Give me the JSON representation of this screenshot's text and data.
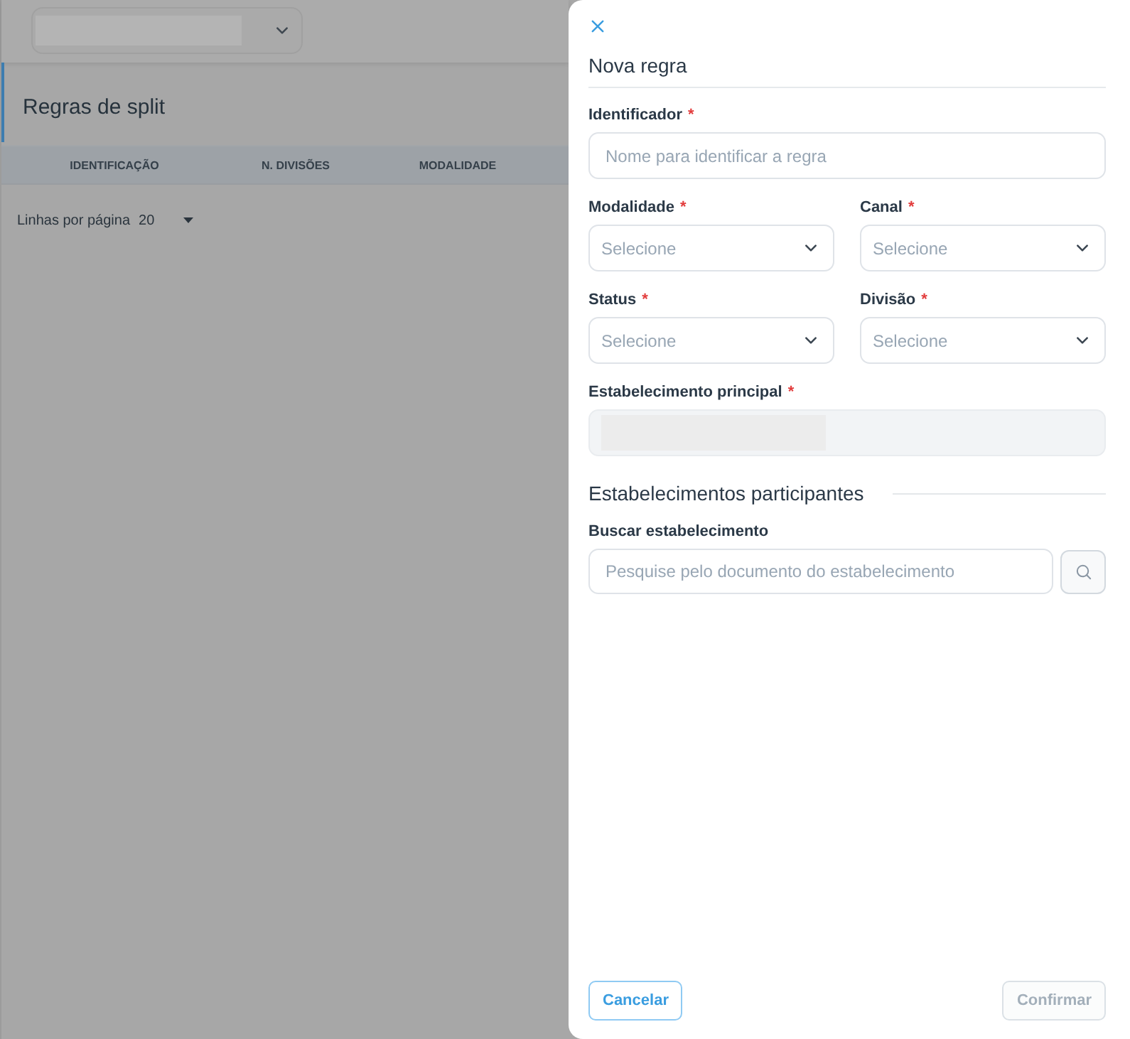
{
  "page": {
    "top_bar": {
      "select": {
        "redacted": true
      }
    },
    "title": "Regras de split",
    "table": {
      "columns": [
        "IDENTIFICAÇÃO",
        "N. DIVISÕES",
        "MODALIDADE"
      ]
    },
    "pagination": {
      "label": "Linhas por página",
      "value": "20"
    }
  },
  "drawer": {
    "title": "Nova regra",
    "rows": [
      [
        {
          "label": "Identificador",
          "required_mark": "*",
          "kind": "text",
          "placeholder": "Nome para identificar a regra",
          "disabled": false,
          "redacted": false
        }
      ],
      [
        {
          "label": "Modalidade",
          "required_mark": "*",
          "kind": "select",
          "placeholder": "Selecione",
          "disabled": false,
          "redacted": false
        },
        {
          "label": "Canal",
          "required_mark": "*",
          "kind": "select",
          "placeholder": "Selecione",
          "disabled": false,
          "redacted": false
        }
      ],
      [
        {
          "label": "Status",
          "required_mark": "*",
          "kind": "select",
          "placeholder": "Selecione",
          "disabled": false,
          "redacted": false
        },
        {
          "label": "Divisão",
          "required_mark": "*",
          "kind": "select",
          "placeholder": "Selecione",
          "disabled": false,
          "redacted": false
        }
      ],
      [
        {
          "label": "Estabelecimento principal",
          "required_mark": "*",
          "kind": "text",
          "disabled": true,
          "redacted": true
        }
      ]
    ],
    "section_title": "Estabelecimentos participantes",
    "search": {
      "label": "Buscar estabelecimento",
      "placeholder": "Pesquise pelo documento do estabelecimento"
    },
    "buttons": [
      {
        "label": "Cancelar",
        "disabled": false
      },
      {
        "label": "Confirmar",
        "disabled": true
      }
    ]
  }
}
